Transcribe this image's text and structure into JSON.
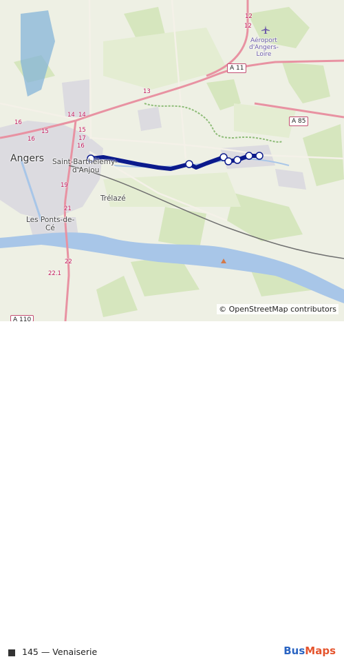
{
  "map": {
    "places": {
      "angers": "Angers",
      "saint_barthelemy_1": "Saint-Barthélemy-",
      "saint_barthelemy_2": "d'Anjou",
      "trelaze": "Trélazé",
      "ponts_1": "Les Ponts-de-",
      "ponts_2": "Cé",
      "airport_1": "Aéroport",
      "airport_2": "d'Angers-",
      "airport_3": "Loire"
    },
    "motorway_shields": {
      "a11": "A 11",
      "a85": "A 85",
      "a_partial": "A 110"
    },
    "junction_numbers": [
      "12",
      "12",
      "13",
      "14",
      "14",
      "15",
      "15",
      "16",
      "16",
      "16",
      "19",
      "21",
      "22",
      "22.1",
      "17"
    ],
    "route": {
      "color": "#0b1a8c"
    },
    "icons": [
      "airport-icon",
      "peak-icon",
      "copyright-icon"
    ],
    "attribution": "© OpenStreetMap contributors"
  },
  "legend": {
    "label": "145 — Venaiserie",
    "swatch_color": "#333333"
  },
  "brand": {
    "part1": "Bus",
    "part2": "Maps"
  }
}
